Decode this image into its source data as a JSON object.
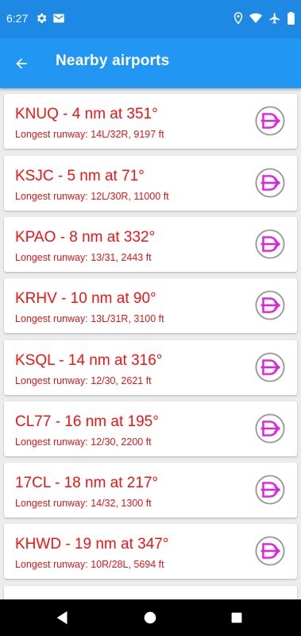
{
  "status_bar": {
    "time": "6:27",
    "left_icons": [
      "gear-icon",
      "mail-icon"
    ],
    "right_icons": [
      "location-icon",
      "wifi-icon",
      "airplane-icon",
      "battery-icon"
    ]
  },
  "app_bar": {
    "back_icon": "arrow-back-icon",
    "title": "Nearby airports",
    "color": "#2196f3"
  },
  "colors": {
    "text_red": "#f01414",
    "direct_icon": "#e020e0"
  },
  "airports": [
    {
      "title": "KNUQ - 4 nm at 351°",
      "runway": "Longest runway: 14L/32R, 9197 ft"
    },
    {
      "title": "KSJC - 5 nm at 71°",
      "runway": "Longest runway: 12L/30R, 11000 ft"
    },
    {
      "title": "KPAO - 8 nm at 332°",
      "runway": "Longest runway: 13/31, 2443 ft"
    },
    {
      "title": "KRHV - 10 nm at 90°",
      "runway": "Longest runway: 13L/31R, 3100 ft"
    },
    {
      "title": "KSQL - 14 nm at 316°",
      "runway": "Longest runway: 12/30, 2621 ft"
    },
    {
      "title": "CL77 - 16 nm at 195°",
      "runway": "Longest runway: 12/30, 2200 ft"
    },
    {
      "title": "17CL - 18 nm at 217°",
      "runway": "Longest runway: 14/32, 1300 ft"
    },
    {
      "title": "KHWD - 19 nm at 347°",
      "runway": "Longest runway: 10R/28L, 5694 ft"
    }
  ],
  "nav_bar": {
    "buttons": [
      "back-triangle-icon",
      "home-circle-icon",
      "recents-square-icon"
    ]
  }
}
